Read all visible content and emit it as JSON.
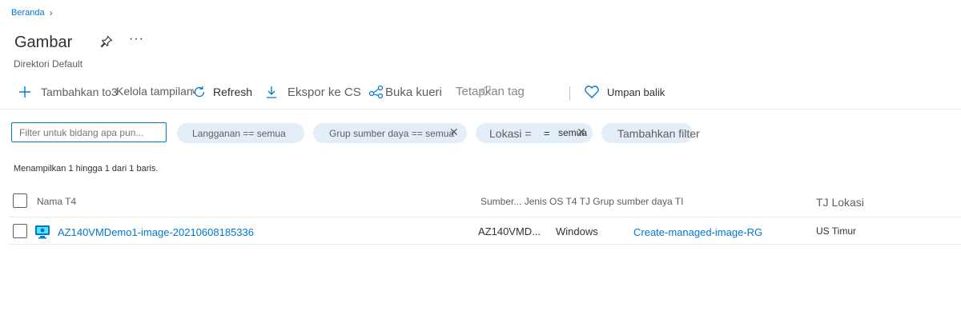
{
  "breadcrumb": {
    "home": "Beranda"
  },
  "page": {
    "title": "Gambar",
    "subtitle": "Direktori Default"
  },
  "toolbar": {
    "add": "Tambahkan to3",
    "manage_view": "Kelola tampilan",
    "refresh": "Refresh",
    "export": "Ekspor ke CS",
    "open_query": "Buka kueri",
    "assign_tags": "Tetapkan tag",
    "feedback": "Umpan balik"
  },
  "filters": {
    "placeholder": "Filter untuk bidang apa pun...",
    "subscription": "Langganan == semua",
    "resource_group": "Grup sumber daya == semua",
    "location_label": "Lokasi =",
    "location_op": "=",
    "location_value": "semua",
    "add_filter": "Tambahkan filter"
  },
  "info": {
    "count_text": "Menampilkan 1 hingga 1 dari 1 baris."
  },
  "table": {
    "headers": {
      "name": "Nama T4",
      "source_os": "Sumber... Jenis OS T4 TJ Grup sumber daya TI",
      "location": "TJ Lokasi"
    },
    "rows": [
      {
        "name": "AZ140VMDemo1-image-20210608185336",
        "source": "AZ140VMD...",
        "os": "Windows",
        "resource_group": "Create-managed-image-RG",
        "location": "US Timur"
      }
    ]
  },
  "colors": {
    "accent": "#0078d4",
    "pill_bg": "#e3eef9"
  }
}
